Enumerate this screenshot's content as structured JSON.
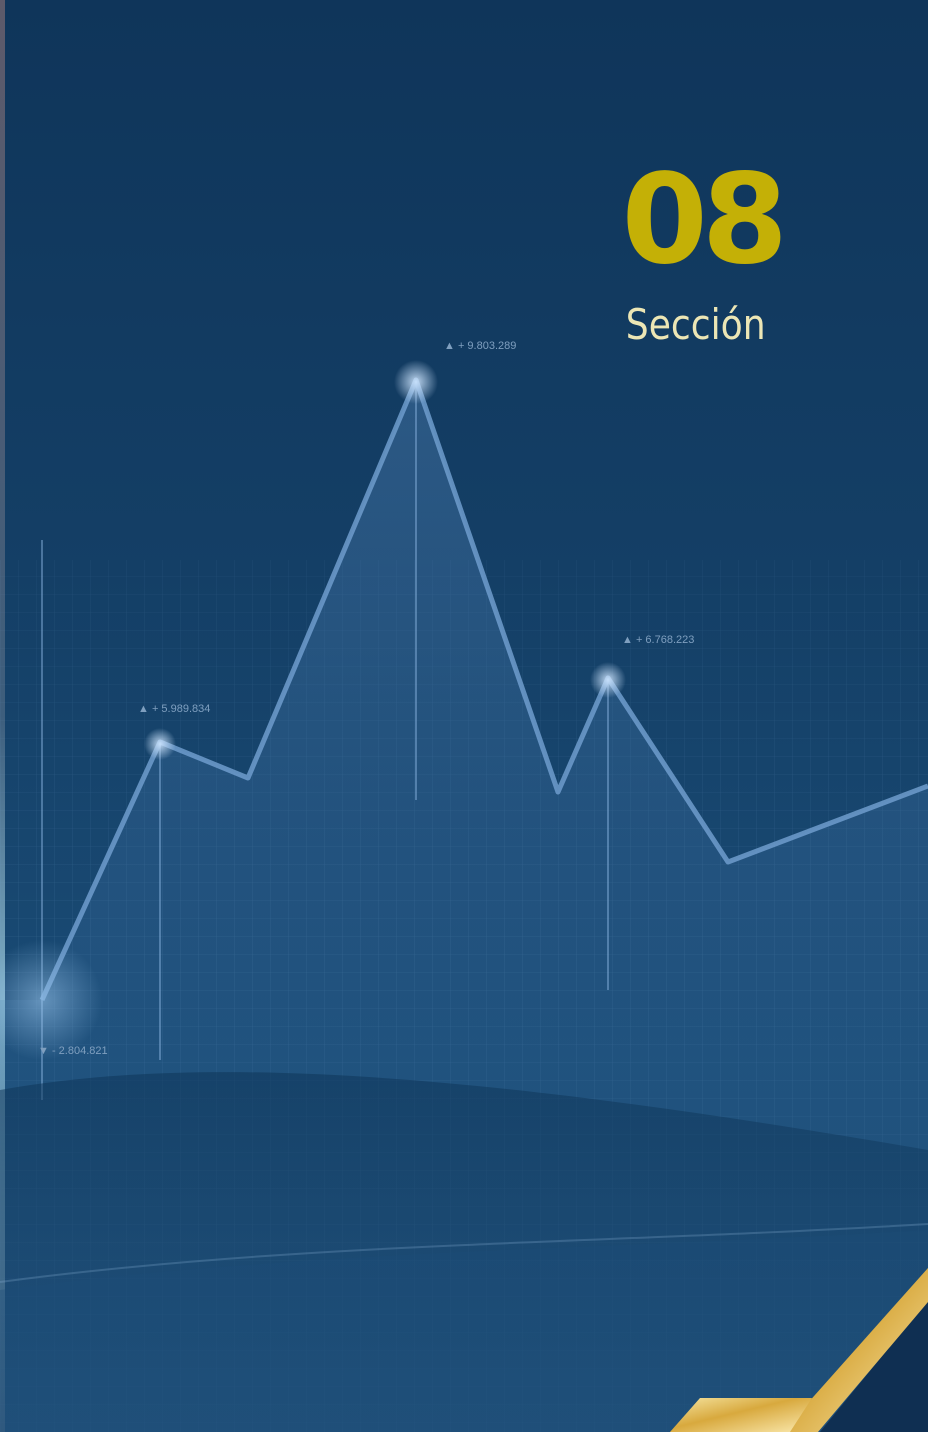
{
  "section": {
    "number": "08",
    "label": "Sección"
  },
  "chart_data": {
    "type": "line",
    "labels": [
      {
        "marker": "▲",
        "text": "+ 9.803.289"
      },
      {
        "marker": "▲",
        "text": "+ 5.989.834"
      },
      {
        "marker": "▲",
        "text": "+ 6.768.223"
      },
      {
        "marker": "▼",
        "text": "- 2.804.821"
      }
    ]
  },
  "colors": {
    "background": "#143f66",
    "number": "#c4b006",
    "label": "#ece6b5",
    "line": "#6f9ccc",
    "ribbon": "#e2bd5a"
  }
}
